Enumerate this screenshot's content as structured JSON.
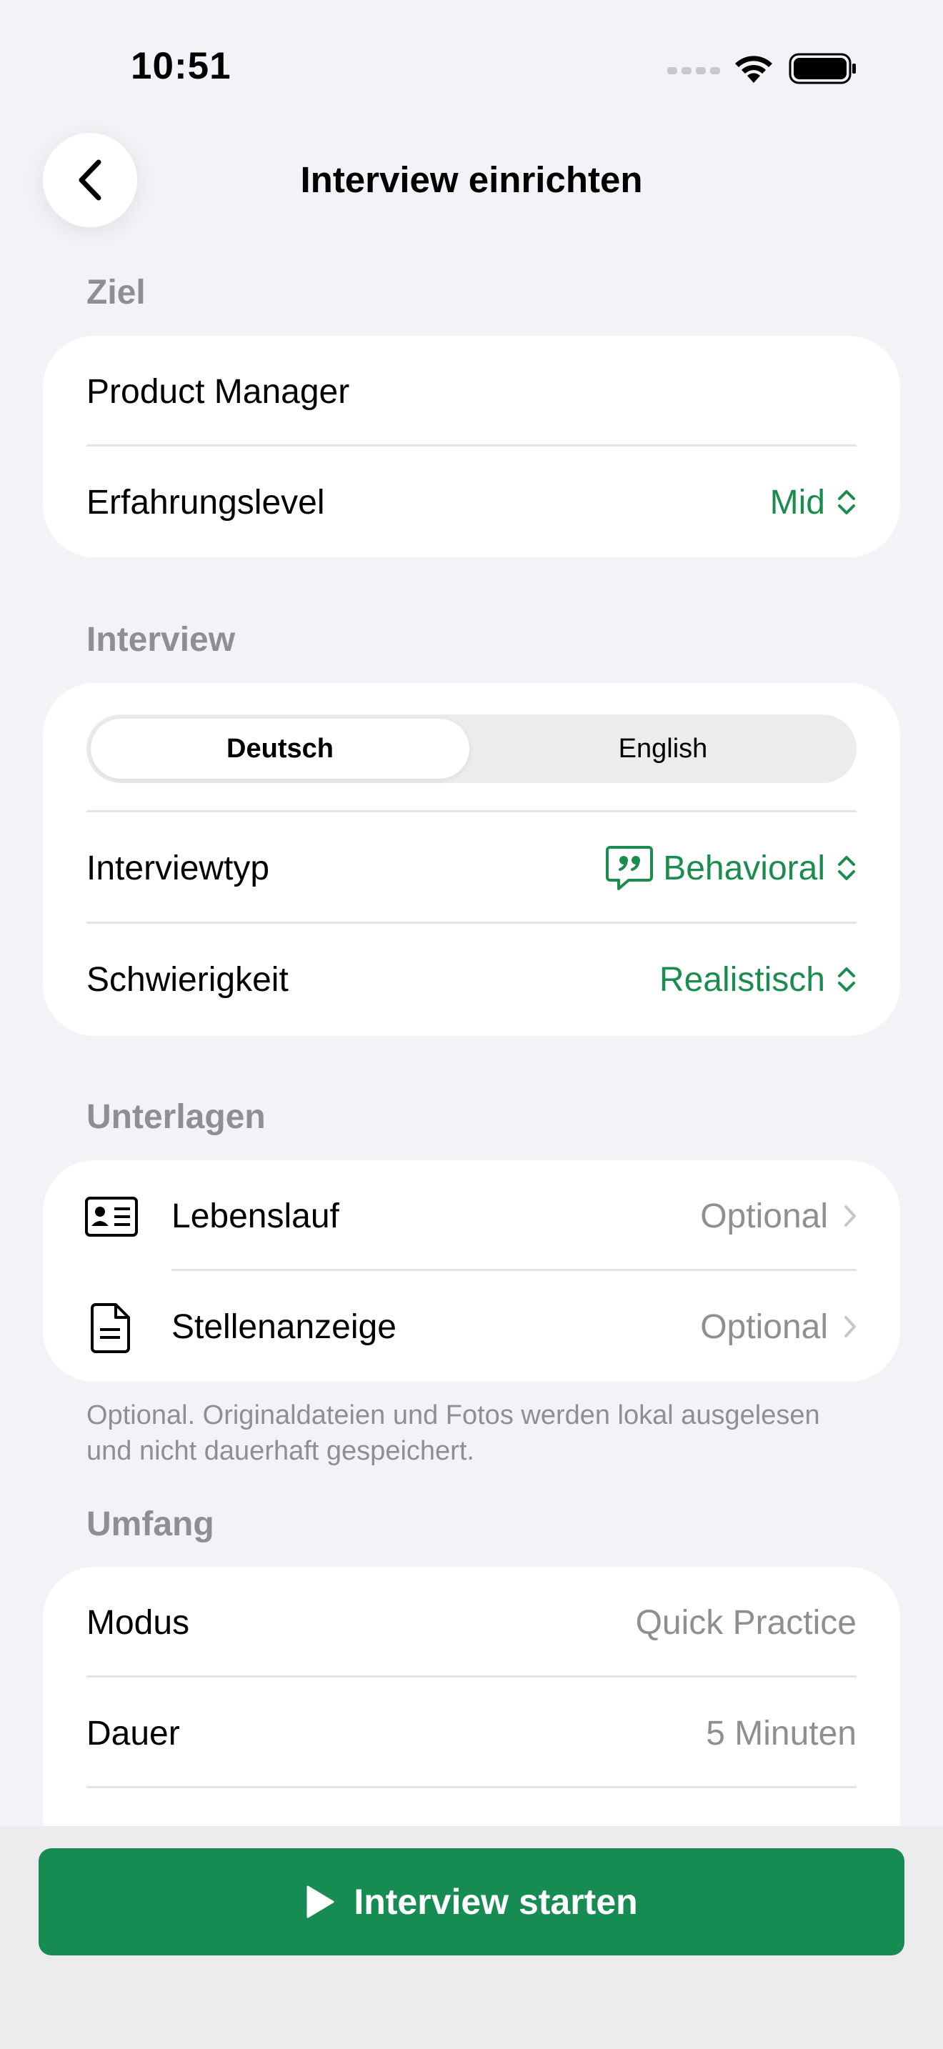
{
  "status_bar": {
    "time": "10:51"
  },
  "nav": {
    "title": "Interview einrichten"
  },
  "sections": {
    "goal": {
      "label": "Ziel",
      "role": "Product Manager",
      "experience_label": "Erfahrungslevel",
      "experience_value": "Mid"
    },
    "interview": {
      "label": "Interview",
      "languages": [
        "Deutsch",
        "English"
      ],
      "selected_language": "Deutsch",
      "type_label": "Interviewtyp",
      "type_value": "Behavioral",
      "difficulty_label": "Schwierigkeit",
      "difficulty_value": "Realistisch"
    },
    "documents": {
      "label": "Unterlagen",
      "resume_label": "Lebenslauf",
      "resume_value": "Optional",
      "job_ad_label": "Stellenanzeige",
      "job_ad_value": "Optional",
      "footnote": "Optional. Originaldateien und Fotos werden lokal ausgelesen und nicht dauerhaft gespeichert."
    },
    "scope": {
      "label": "Umfang",
      "mode_label": "Modus",
      "mode_value": "Quick Practice",
      "duration_label": "Dauer",
      "duration_value": "5 Minuten"
    }
  },
  "actions": {
    "start_label": "Interview starten"
  },
  "colors": {
    "accent": "#1a8c4e",
    "button": "#178c52",
    "background": "#f2f2f7"
  },
  "icons": [
    "back-chevron-icon",
    "signal-icon",
    "wifi-icon",
    "battery-icon",
    "quote-bubble-icon",
    "up-down-chevron-icon",
    "id-card-icon",
    "document-icon",
    "chevron-right-icon",
    "play-icon"
  ]
}
